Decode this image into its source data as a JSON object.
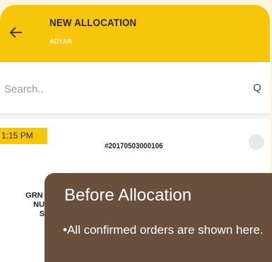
{
  "header": {
    "title": "NEW ALLOCATION",
    "subtitle": "ADYAR",
    "accent": "#f7c50a"
  },
  "search": {
    "placeholder": "Search..",
    "button_label": "Q"
  },
  "orders": [
    {
      "time": "1:15 PM",
      "order_id": "#20170503000106",
      "details": [
        "GRN S",
        "NUN",
        "SA"
      ]
    }
  ],
  "overlay": {
    "title": "Before Allocation",
    "bullet": "•",
    "text": "All confirmed orders are shown here.",
    "color": "#6b4f3d"
  }
}
